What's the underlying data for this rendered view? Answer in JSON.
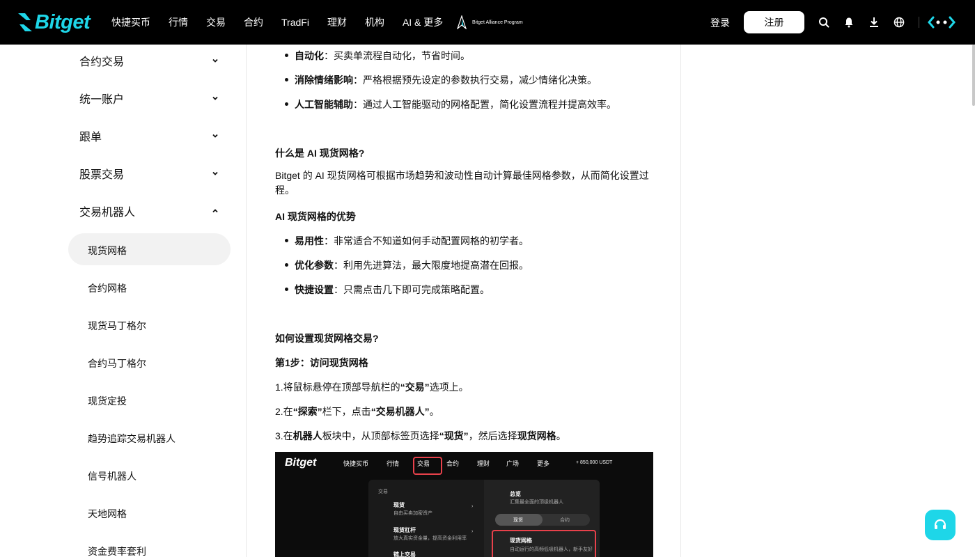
{
  "header": {
    "logo_text": "Bitget",
    "nav": [
      "快捷买币",
      "行情",
      "交易",
      "合约",
      "TradFi",
      "理财",
      "机构",
      "AI & 更多"
    ],
    "alliance_text": "Bitget Alliance Program",
    "login_label": "登录",
    "register_label": "注册",
    "icons": [
      "search-icon",
      "bell-icon",
      "download-icon",
      "globe-icon",
      "brand-icon"
    ]
  },
  "sidebar": {
    "groups": [
      {
        "label": "合约交易",
        "expanded": false
      },
      {
        "label": "统一账户",
        "expanded": false
      },
      {
        "label": "跟单",
        "expanded": false
      },
      {
        "label": "股票交易",
        "expanded": false
      },
      {
        "label": "交易机器人",
        "expanded": true
      }
    ],
    "subitems": [
      "现货网格",
      "合约网格",
      "现货马丁格尔",
      "合约马丁格尔",
      "现货定投",
      "趋势追踪交易机器人",
      "信号机器人",
      "天地网格",
      "资金费率套利"
    ],
    "active_subitem": "现货网格"
  },
  "article": {
    "bullets_top": [
      {
        "bold": "自动化",
        "text": "：买卖单流程自动化，节省时间。"
      },
      {
        "bold": "消除情绪影响",
        "text": "：严格根据预先设定的参数执行交易，减少情绪化决策。"
      },
      {
        "bold": "人工智能辅助",
        "text": "：通过人工智能驱动的网格配置，简化设置流程并提高效率。"
      }
    ],
    "heading_ai": "什么是 AI 现货网格?",
    "para_ai": "Bitget 的 AI 现货网格可根据市场趋势和波动性自动计算最佳网格参数，从而简化设置过程。",
    "heading_adv": "AI 现货网格的优势",
    "bullets_adv": [
      {
        "bold": "易用性",
        "text": "：非常适合不知道如何手动配置网格的初学者。"
      },
      {
        "bold": "优化参数",
        "text": "：利用先进算法，最大限度地提高潜在回报。"
      },
      {
        "bold": "快捷设置",
        "text": "：只需点击几下即可完成策略配置。"
      }
    ],
    "heading_setup": "如何设置现货网格交易?",
    "heading_step1": "第1步：访问现货网格",
    "step1": {
      "pre": "1.将鼠标悬停在顶部导航栏的",
      "bold": "“交易”",
      "post": "选项上。"
    },
    "step2": {
      "pre": "2.在",
      "bold1": "“探索”",
      "mid": "栏下，点击",
      "bold2": "“交易机器人”",
      "post": "。"
    },
    "step3": {
      "pre": "3.在",
      "bold1": "机器人",
      "mid1": "板块中，从顶部标签页选择",
      "bold2": "“现货”",
      "mid2": "，然后选择",
      "bold3": "现货网格",
      "post": "。"
    }
  },
  "screenshot": {
    "logo": "Bitget",
    "nav": [
      "快捷买币",
      "行情",
      "交易",
      "合约",
      "理财",
      "广场",
      "更多"
    ],
    "promo": "+ 850,000 USDT",
    "section_label": "交易",
    "left_items": [
      {
        "title": "现货",
        "desc": "自由买卖加密资产"
      },
      {
        "title": "现货杠杆",
        "desc": "放大真实资金量，提高资金利用率"
      },
      {
        "title": "链上交易",
        "desc": ""
      }
    ],
    "overview_title": "总览",
    "overview_desc": "汇集最全面的顶级机器人",
    "tab_spot": "现货",
    "tab_futures": "合约",
    "grid_title": "现货网格",
    "grid_desc": "自动运行的高频低吸机器人，新手友好"
  },
  "colors": {
    "brand": "#1ed6e8",
    "highlight": "#e8414b",
    "header_bg": "#000000"
  }
}
